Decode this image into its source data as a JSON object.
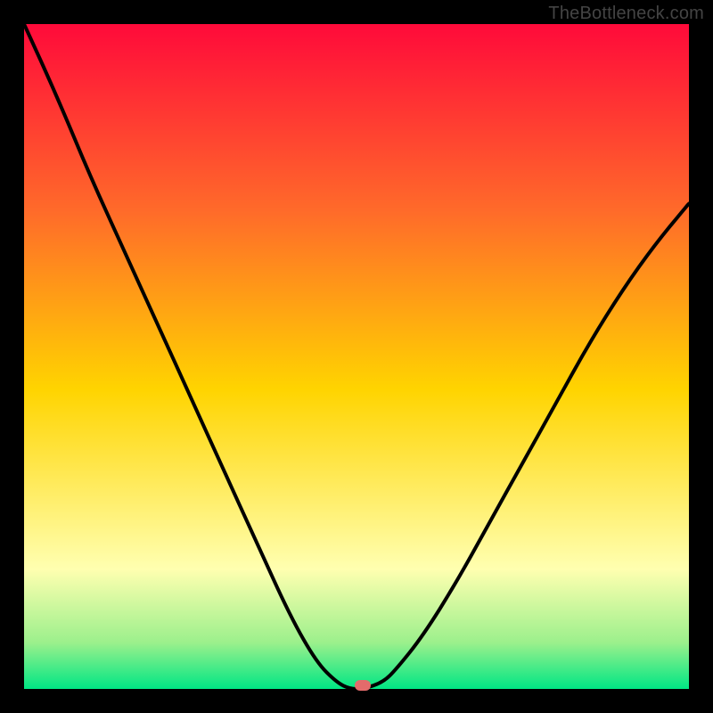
{
  "watermark": "TheBottleneck.com",
  "colors": {
    "top": "#ff0a3a",
    "upper_mid": "#ff6a2a",
    "mid": "#ffd400",
    "lower_pale": "#ffffb0",
    "near_bottom": "#9cf08c",
    "bottom": "#00e684",
    "curve": "#000000",
    "marker": "#e36b6b",
    "frame": "#000000"
  },
  "chart_data": {
    "type": "line",
    "title": "",
    "xlabel": "",
    "ylabel": "",
    "xlim": [
      0,
      1
    ],
    "ylim": [
      0,
      1
    ],
    "series": [
      {
        "name": "bottleneck-curve",
        "x": [
          0.0,
          0.05,
          0.1,
          0.15,
          0.2,
          0.25,
          0.3,
          0.35,
          0.4,
          0.44,
          0.47,
          0.49,
          0.51,
          0.54,
          0.56,
          0.6,
          0.65,
          0.7,
          0.75,
          0.8,
          0.85,
          0.9,
          0.95,
          1.0
        ],
        "y": [
          1.0,
          0.89,
          0.77,
          0.66,
          0.55,
          0.44,
          0.33,
          0.22,
          0.11,
          0.04,
          0.01,
          0.0,
          0.0,
          0.01,
          0.03,
          0.08,
          0.16,
          0.25,
          0.34,
          0.43,
          0.52,
          0.6,
          0.67,
          0.73
        ]
      }
    ],
    "marker": {
      "x": 0.51,
      "y": 0.005
    },
    "gradient_stops": [
      {
        "offset": 0.0,
        "color": "#ff0a3a"
      },
      {
        "offset": 0.28,
        "color": "#ff6a2a"
      },
      {
        "offset": 0.55,
        "color": "#ffd400"
      },
      {
        "offset": 0.82,
        "color": "#ffffb0"
      },
      {
        "offset": 0.93,
        "color": "#9cf08c"
      },
      {
        "offset": 1.0,
        "color": "#00e684"
      }
    ]
  }
}
